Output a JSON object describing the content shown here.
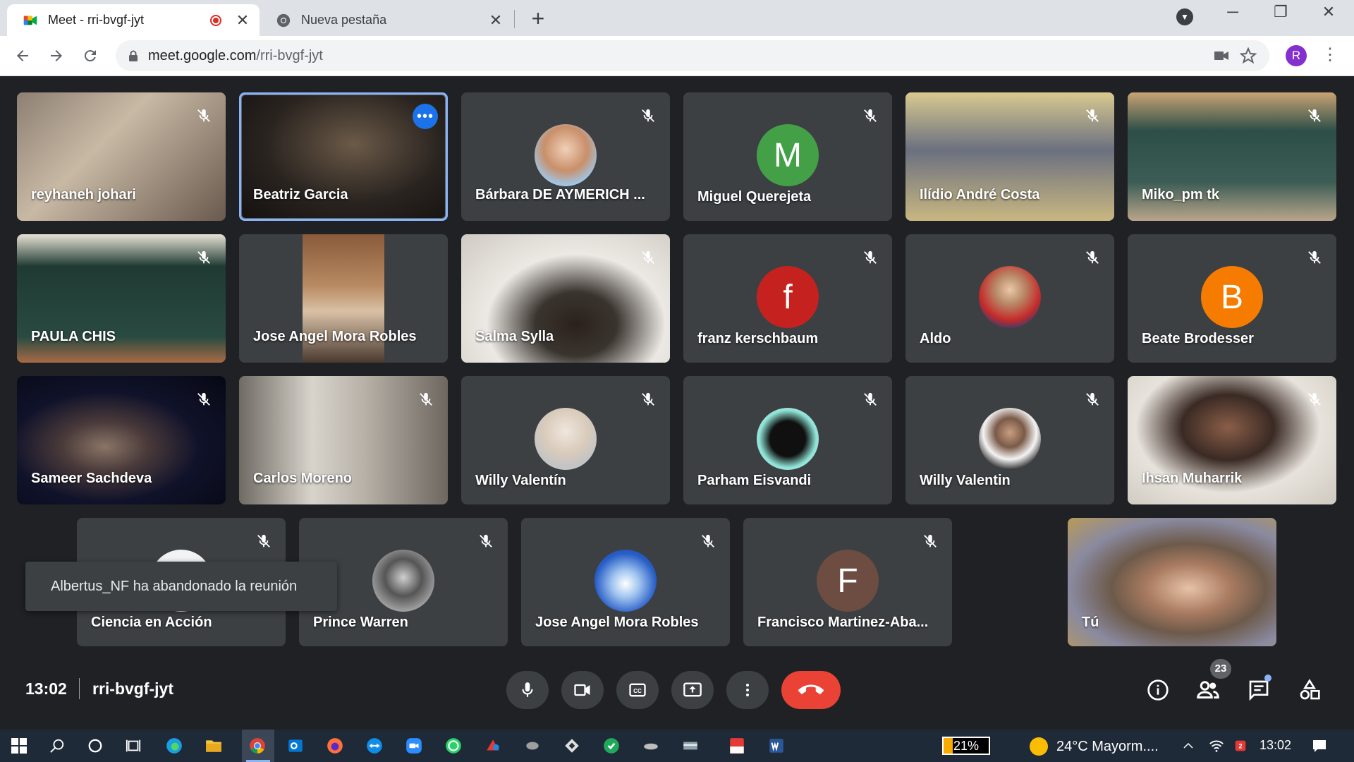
{
  "browser": {
    "tabs": [
      {
        "title": "Meet - rri-bvgf-jyt",
        "close": "✕"
      },
      {
        "title": "Nueva pestaña",
        "close": "✕"
      }
    ],
    "new_tab": "+",
    "window_controls": {
      "minimize": "─",
      "restore": "❐",
      "close": "✕"
    },
    "url_host": "meet.google.com",
    "url_path": "/rri-bvgf-jyt",
    "profile_initial": "R"
  },
  "meeting": {
    "time": "13:02",
    "code": "rri-bvgf-jyt",
    "participant_count": "23",
    "toast": "Albertus_NF ha abandonado la reunión",
    "tiles": [
      {
        "name": "reyhaneh johari",
        "kind": "video",
        "muted": true
      },
      {
        "name": "Beatriz Garcia",
        "kind": "video",
        "muted": false,
        "active_speaker": true
      },
      {
        "name": "Bárbara DE AYMERICH ...",
        "kind": "photo",
        "muted": true
      },
      {
        "name": "Miguel Querejeta",
        "kind": "initial",
        "initial": "M",
        "color": "#43a047",
        "muted": true
      },
      {
        "name": "Ilídio André Costa",
        "kind": "video",
        "muted": true
      },
      {
        "name": "Miko_pm tk",
        "kind": "video",
        "muted": true
      },
      {
        "name": "PAULA CHIS",
        "kind": "video",
        "muted": true
      },
      {
        "name": "Jose Angel Mora Robles",
        "kind": "video",
        "muted": false
      },
      {
        "name": "Salma Sylla",
        "kind": "video",
        "muted": true
      },
      {
        "name": "franz kerschbaum",
        "kind": "initial",
        "initial": "f",
        "color": "#c5221f",
        "muted": true
      },
      {
        "name": "Aldo",
        "kind": "photo",
        "muted": true
      },
      {
        "name": "Beate Brodesser",
        "kind": "initial",
        "initial": "B",
        "color": "#f57c00",
        "muted": true
      },
      {
        "name": "Sameer Sachdeva",
        "kind": "video",
        "muted": true
      },
      {
        "name": "Carlos Moreno",
        "kind": "video",
        "muted": true
      },
      {
        "name": "Willy Valentín",
        "kind": "photo",
        "muted": true
      },
      {
        "name": "Parham Eisvandi",
        "kind": "photo",
        "muted": true
      },
      {
        "name": "Willy Valentin",
        "kind": "photo",
        "muted": true
      },
      {
        "name": "Ihsan Muharrik",
        "kind": "video",
        "muted": true
      },
      {
        "name": "Ciencia en Acción",
        "kind": "photo",
        "muted": true
      },
      {
        "name": "Prince Warren",
        "kind": "photo",
        "muted": true
      },
      {
        "name": "Jose Angel Mora Robles",
        "kind": "photo",
        "muted": true
      },
      {
        "name": "Francisco Martinez-Aba...",
        "kind": "initial",
        "initial": "F",
        "color": "#6d4c41",
        "muted": true
      },
      {
        "name": "Tú",
        "kind": "video",
        "muted": false,
        "self": true
      }
    ]
  },
  "taskbar": {
    "battery": "21%",
    "battery_level": 0.21,
    "weather": "24°C  Mayorm....",
    "clock": "13:02"
  }
}
